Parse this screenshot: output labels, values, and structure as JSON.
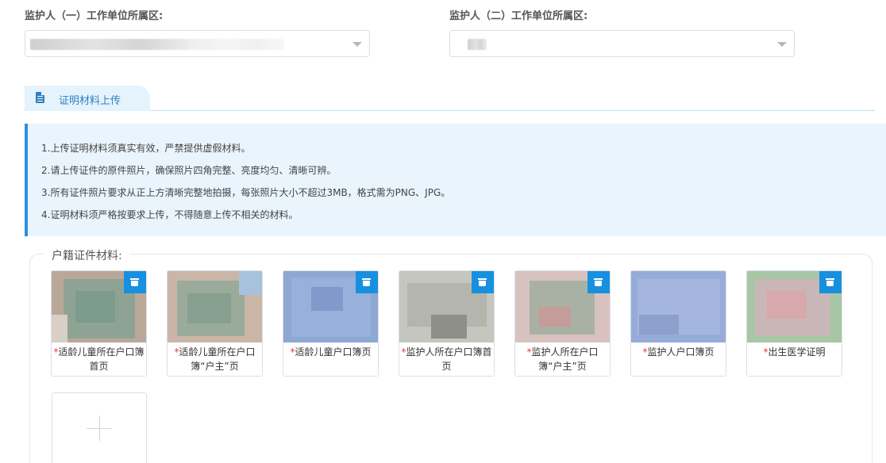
{
  "guardian1": {
    "label": "监护人（一）工作单位所属区:"
  },
  "guardian2": {
    "label": "监护人（二）工作单位所属区:"
  },
  "tab": {
    "label": "证明材料上传"
  },
  "notice": [
    "1.上传证明材料须真实有效，严禁提供虚假材料。",
    "2.请上传证件的原件照片，确保照片四角完整、亮度均匀、清晰可辨。",
    "3.所有证件照片要求从正上方清晰完整地拍摄，每张照片大小不超过3MB，格式需为PNG、JPG。",
    "4.证明材料须严格按要求上传，不得随意上传不相关的材料。"
  ],
  "section": {
    "title": "户籍证件材料:"
  },
  "cards": [
    {
      "required": "*",
      "label": "适龄儿童所在户口簿首页"
    },
    {
      "required": "*",
      "label": "适龄儿童所在户口簿“户主”页"
    },
    {
      "required": "*",
      "label": "适龄儿童户口簿页"
    },
    {
      "required": "*",
      "label": "监护人所在户口簿首页"
    },
    {
      "required": "*",
      "label": "监护人所在户口簿“户主”页"
    },
    {
      "required": "*",
      "label": "监护人户口簿页"
    },
    {
      "required": "*",
      "label": "出生医学证明"
    }
  ],
  "colors": {
    "accent": "#2f8fdb",
    "required": "#ee3333",
    "notice_bg": "#e9f4fd"
  }
}
